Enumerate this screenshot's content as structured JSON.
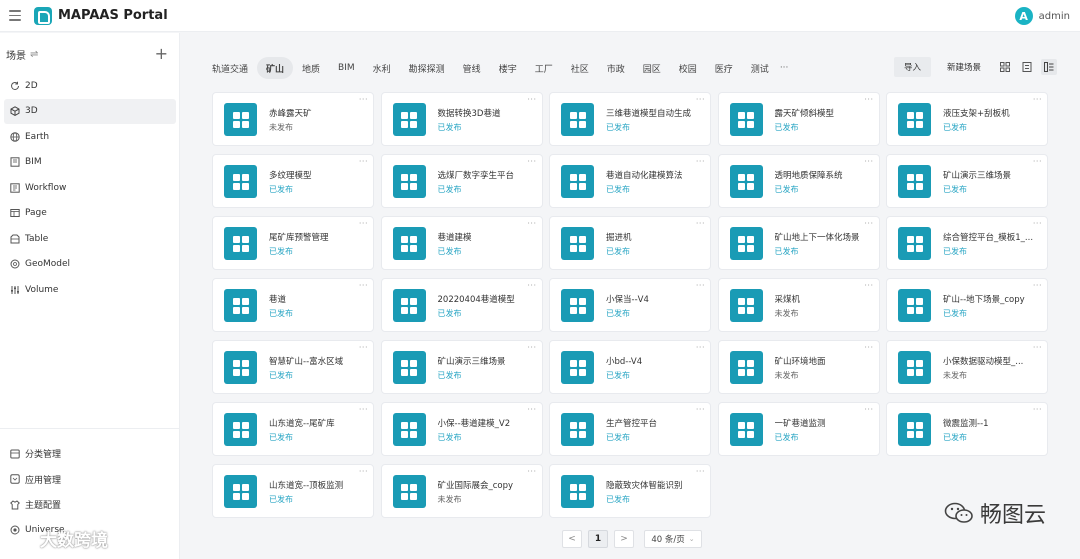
{
  "app": {
    "title": "MAPAAS Portal"
  },
  "user": {
    "initial": "A",
    "name": "admin"
  },
  "sidebar": {
    "header": "场景",
    "items": [
      {
        "label": "2D",
        "icon": "cycle-icon"
      },
      {
        "label": "3D",
        "icon": "cube-icon",
        "active": true
      },
      {
        "label": "Earth",
        "icon": "globe-icon"
      },
      {
        "label": "BIM",
        "icon": "building-icon"
      },
      {
        "label": "Workflow",
        "icon": "workflow-icon"
      },
      {
        "label": "Page",
        "icon": "page-icon"
      },
      {
        "label": "Table",
        "icon": "table-icon"
      },
      {
        "label": "GeoModel",
        "icon": "geomodel-icon"
      },
      {
        "label": "Volume",
        "icon": "volume-icon"
      }
    ],
    "bottom_items": [
      {
        "label": "分类管理",
        "icon": "category-icon"
      },
      {
        "label": "应用管理",
        "icon": "app-icon"
      },
      {
        "label": "主题配置",
        "icon": "theme-icon"
      },
      {
        "label": "Universe",
        "icon": "universe-icon"
      }
    ]
  },
  "tabs": [
    "轨道交通",
    "矿山",
    "地质",
    "BIM",
    "水利",
    "勘探探测",
    "管线",
    "楼宇",
    "工厂",
    "社区",
    "市政",
    "园区",
    "校园",
    "医疗",
    "测试"
  ],
  "active_tab": 1,
  "tabs_more": "···",
  "toolbar": {
    "import_label": "导入",
    "new_label": "新建场景"
  },
  "cards": [
    {
      "title": "赤峰露天矿",
      "status": "未发布"
    },
    {
      "title": "数据转换3D巷道",
      "status": "已发布"
    },
    {
      "title": "三维巷道模型自动生成",
      "status": "已发布"
    },
    {
      "title": "露天矿倾斜模型",
      "status": "已发布"
    },
    {
      "title": "液压支架+刮板机",
      "status": "已发布"
    },
    {
      "title": "多纹理模型",
      "status": "已发布"
    },
    {
      "title": "选煤厂数字孪生平台",
      "status": "已发布"
    },
    {
      "title": "巷道自动化建模算法",
      "status": "已发布"
    },
    {
      "title": "透明地质保障系统",
      "status": "已发布"
    },
    {
      "title": "矿山演示三维场景",
      "status": "已发布"
    },
    {
      "title": "尾矿库预警管理",
      "status": "已发布"
    },
    {
      "title": "巷道建模",
      "status": "已发布"
    },
    {
      "title": "掘进机",
      "status": "已发布"
    },
    {
      "title": "矿山地上下一体化场景",
      "status": "已发布"
    },
    {
      "title": "综合管控平台_模板1_...",
      "status": "已发布"
    },
    {
      "title": "巷道",
      "status": "已发布"
    },
    {
      "title": "20220404巷道模型",
      "status": "已发布"
    },
    {
      "title": "小保当--V4",
      "status": "已发布"
    },
    {
      "title": "采煤机",
      "status": "未发布"
    },
    {
      "title": "矿山--地下场景_copy",
      "status": "已发布"
    },
    {
      "title": "智慧矿山--富水区域",
      "status": "已发布"
    },
    {
      "title": "矿山演示三维场景",
      "status": "已发布"
    },
    {
      "title": "小bd--V4",
      "status": "已发布"
    },
    {
      "title": "矿山环境地面",
      "status": "未发布"
    },
    {
      "title": "小保数据驱动模型_...",
      "status": "未发布"
    },
    {
      "title": "山东道宽--尾矿库",
      "status": "已发布"
    },
    {
      "title": "小保--巷道建模_V2",
      "status": "已发布"
    },
    {
      "title": "生产管控平台",
      "status": "已发布"
    },
    {
      "title": "一矿巷道监测",
      "status": "已发布"
    },
    {
      "title": "微震监测--1",
      "status": "已发布"
    },
    {
      "title": "山东道宽--顶板监测",
      "status": "已发布"
    },
    {
      "title": "矿业国际展会_copy",
      "status": "未发布"
    },
    {
      "title": "隐蔽致灾体智能识别",
      "status": "已发布"
    }
  ],
  "card_more": "···",
  "pagination": {
    "prev": "<",
    "current": "1",
    "next": ">",
    "page_size": "40 条/页"
  },
  "watermarks": {
    "right": "畅图云",
    "left": "大数跨境"
  },
  "colors": {
    "accent": "#1a9bb5",
    "published": "#2aa6c4",
    "avatar": "#1ab3c4"
  }
}
